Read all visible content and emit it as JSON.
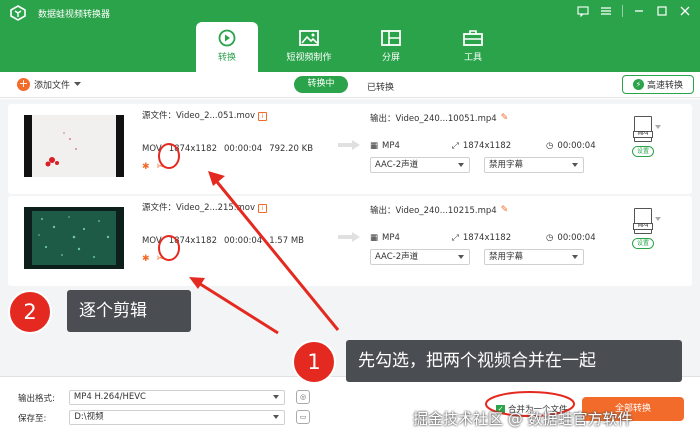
{
  "window": {
    "title": "数据蛙视频转换器"
  },
  "tabs": [
    {
      "label": "转换",
      "icon": "convert-icon",
      "active": true
    },
    {
      "label": "短视频制作",
      "icon": "image-icon",
      "active": false
    },
    {
      "label": "分屏",
      "icon": "split-screen-icon",
      "active": false
    },
    {
      "label": "工具",
      "icon": "toolbox-icon",
      "active": false
    }
  ],
  "toolbar": {
    "add_file": "添加文件",
    "converting": "转换中",
    "converted": "已转换",
    "high_speed": "高速转换"
  },
  "items": [
    {
      "source": "源文件：Video_2...051.mov",
      "format": "MOV",
      "resolution": "1874x1182",
      "duration": "00:00:04",
      "size": "792.20 KB",
      "output": "输出：Video_240...10051.mp4",
      "out_format": "MP4",
      "out_resolution": "1874x1182",
      "out_duration": "00:00:04",
      "audio": "AAC-2声道",
      "subtitle": "禁用字幕",
      "fmt_tag": "MP4",
      "settings": "设置"
    },
    {
      "source": "源文件：Video_2...215.mov",
      "format": "MOV",
      "resolution": "1874x1182",
      "duration": "00:00:04",
      "size": "1.57 MB",
      "output": "输出：Video_240...10215.mp4",
      "out_format": "MP4",
      "out_resolution": "1874x1182",
      "out_duration": "00:00:04",
      "audio": "AAC-2声道",
      "subtitle": "禁用字幕",
      "fmt_tag": "MP4",
      "settings": "设置"
    }
  ],
  "bottom": {
    "output_format_label": "输出格式:",
    "output_format_value": "MP4 H.264/HEVC",
    "save_to_label": "保存至:",
    "save_to_value": "D:\\视频",
    "merge_label": "合并为一个文件",
    "convert_all": "全部转换"
  },
  "annotations": {
    "badge_1": "1",
    "callout_1": "先勾选，把两个视频合并在一起",
    "badge_2": "2",
    "callout_2": "逐个剪辑"
  },
  "watermark": "掘金技术社区 @ 数据蛙官方软件",
  "colors": {
    "brand_green": "#2aa34a",
    "accent_orange": "#f36b2a",
    "annotation_red": "#e42a20"
  }
}
